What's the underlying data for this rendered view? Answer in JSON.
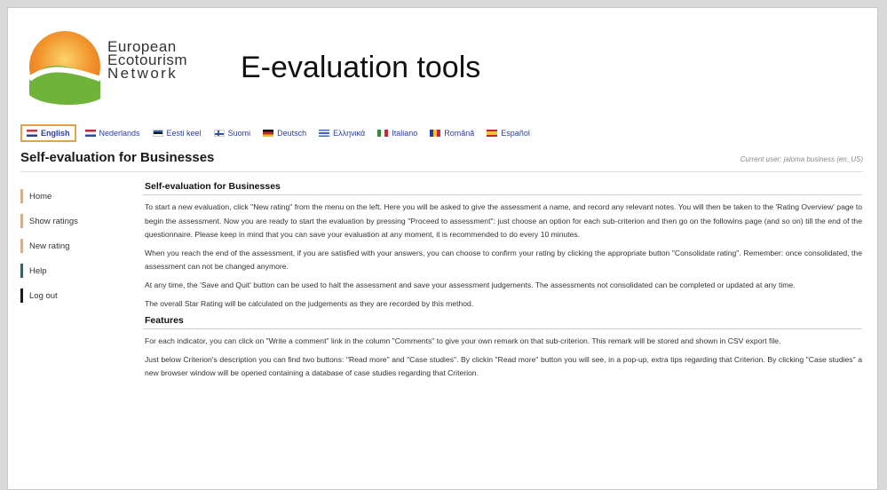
{
  "brand": {
    "logo_lines": [
      "European",
      "Ecotourism",
      "Network"
    ],
    "site_title": "E-evaluation tools"
  },
  "languages": [
    {
      "label": "English",
      "flag": "gb",
      "active": true
    },
    {
      "label": "Nederlands",
      "flag": "nl",
      "active": false
    },
    {
      "label": "Eesti keel",
      "flag": "ee",
      "active": false
    },
    {
      "label": "Suomi",
      "flag": "fi",
      "active": false
    },
    {
      "label": "Deutsch",
      "flag": "de",
      "active": false
    },
    {
      "label": "Ελληνικά",
      "flag": "gr",
      "active": false
    },
    {
      "label": "Italiano",
      "flag": "it",
      "active": false
    },
    {
      "label": "Română",
      "flag": "ro",
      "active": false
    },
    {
      "label": "Español",
      "flag": "es",
      "active": false
    }
  ],
  "page": {
    "title": "Self-evaluation for Businesses",
    "current_user": "Current user: jaloma business (en_US)"
  },
  "sidebar": {
    "items": [
      {
        "label": "Home",
        "color": "#f0a76e"
      },
      {
        "label": "Show ratings",
        "color": "#f0a76e"
      },
      {
        "label": "New rating",
        "color": "#f0a76e"
      },
      {
        "label": "Help",
        "color": "#1f6e64"
      },
      {
        "label": "Log out",
        "color": "#1c1c1c"
      }
    ]
  },
  "content": {
    "heading": "Self-evaluation for Businesses",
    "paragraphs": [
      "To start a new evaluation, click \"New rating\" from the menu on the left. Here you will be asked to give the assessment a name, and record any relevant notes. You will then be taken to the 'Rating Overview' page to begin the assessment. Now you are ready to start the evaluation by pressing \"Proceed to assessment\": just choose an option for each sub-criterion and then go on the followins page (and so on) till the end of the questionnaire. Please keep in mind that you can save your evaluation at any moment, it is recommended to do every 10 minutes.",
      "When you reach the end of the assessment, if you are satisfied with your answers, you can choose to confirm your rating by clicking the appropriate button \"Consolidate rating\". Remember: once consolidated, the assessment can not be changed anymore.",
      "At any time, the 'Save and Quit' button can be used to halt the assessment and save your assessment judgements. The assessments not consolidated can be completed or updated at any time.",
      "The overall Star Rating will be calculated on the judgements as they are recorded by this method."
    ],
    "features_heading": "Features",
    "features_paragraphs": [
      "For each indicator, you can click on \"Write a comment\" link in the column \"Comments\" to give your own remark on that sub-criterion. This remark will be stored and shown in CSV export file.",
      "Just below Criterion's description you can find two buttons: \"Read more\" and \"Case studies\". By clickin \"Read more\" button you will see, in a pop-up, extra tips regarding that Criterion. By clicking \"Case studies\" a new browser window will be opened containing a database of case studies regarding that Criterion."
    ]
  }
}
